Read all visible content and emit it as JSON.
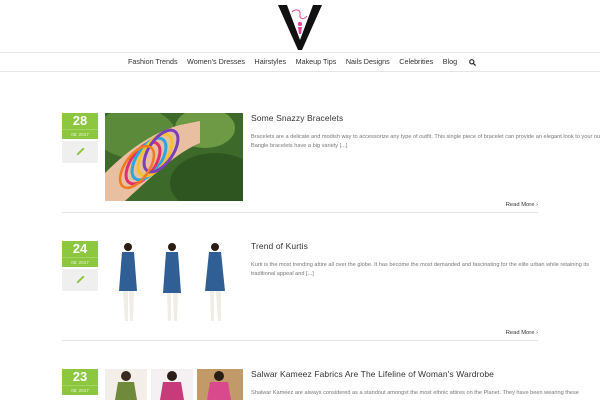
{
  "site": {
    "logo_letter": "V",
    "logo_script": "Fashion"
  },
  "nav": {
    "items": [
      "Fashion Trends",
      "Women's Dresses",
      "Hairstyles",
      "Makeup Tips",
      "Nails Designs",
      "Celebrities",
      "Blog"
    ]
  },
  "posts": [
    {
      "day": "28",
      "month_year": "08, 2017",
      "title": "Some Snazzy Bracelets",
      "excerpt": "Bracelets are a delicate and modish way to accessorize any type of outfit. This single piece of bracelet can provide an elegant look to your outfit. Bangle bracelets have a big variety [...]",
      "read_more": "Read More"
    },
    {
      "day": "24",
      "month_year": "08, 2017",
      "title": "Trend of Kurtis",
      "excerpt": "Kurti is the most trending attire all over the globe. It has become the most demanded and fascinating for the elite urban while retaining its traditional appeal and [...]",
      "read_more": "Read More"
    },
    {
      "day": "23",
      "month_year": "08, 2017",
      "title": "Salwar Kameez Fabrics Are The Lifeline of Woman's Wardrobe",
      "excerpt": "Shalwar Kameez are always considered as a standout amongst the most ethnic attires on the Planet. They have been wearing these",
      "read_more": "Read More"
    }
  ],
  "colors": {
    "accent_green": "#8dc63f",
    "format_box": "#efefef",
    "separator": "#e4e4e4"
  },
  "icons": {
    "format": "link-icon",
    "search": "search-icon",
    "read_more": "chevron-right-icon"
  }
}
